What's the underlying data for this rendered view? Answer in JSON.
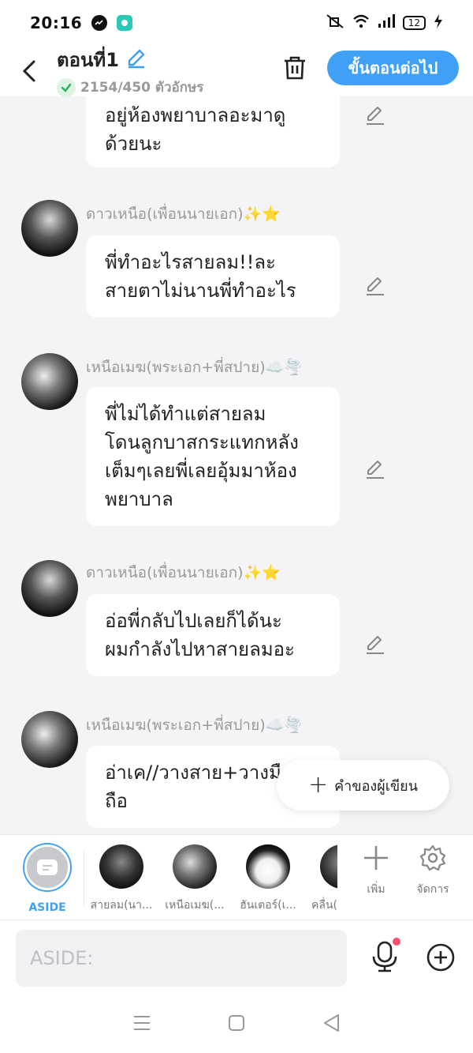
{
  "status_bar": {
    "time": "20:16",
    "battery": "12"
  },
  "header": {
    "title": "ตอนที่1",
    "counter": "2154/450 ตัวอักษร",
    "next_label": "ขั้นตอนต่อไป"
  },
  "messages": [
    {
      "sender": "",
      "text": "อยู่ห้องพยาบาลอะมาดูด้วยนะ",
      "lines": [
        "อยู่ห้องพยาบาลอะมาดู",
        "ด้วยนะ"
      ]
    },
    {
      "sender": "ดาวเหนือ(เพื่อนนายเอก)✨⭐",
      "lines": [
        "พี่ทำอะไรสายลม!!ละ",
        "สายตาไม่นานพี่ทำอะไร"
      ]
    },
    {
      "sender": "เหนือเมฆ(พระเอก+พี่สปาย)☁️🌪️",
      "lines": [
        "พี่ไม่ได้ทำแต่สายลม",
        "โดนลูกบาสกระแทกหลัง",
        "เต็มๆเลยพี่เลยอุ้มมาห้อง",
        "พยาบาล"
      ]
    },
    {
      "sender": "ดาวเหนือ(เพื่อนนายเอก)✨⭐",
      "lines": [
        "อ่อพี่กลับไปเลยก็ได้นะ",
        "ผมกำลังไปหาสายลมอะ"
      ]
    },
    {
      "sender": "เหนือเมฆ(พระเอก+พี่สปาย)☁️🌪️",
      "lines": [
        "อ่าเค//วางสาย+วางมือ",
        "ถือ"
      ]
    }
  ],
  "fab": {
    "label": "คำของผู้เขียน"
  },
  "characters": [
    {
      "label": "ASIDE"
    },
    {
      "label": "สายลม(นา..."
    },
    {
      "label": "เหนือเมฆ(..."
    },
    {
      "label": "ฮันเตอร์(เ..."
    },
    {
      "label": "คลื่น("
    }
  ],
  "tools": {
    "add_label": "เพิ่ม",
    "manage_label": "จัดการ"
  },
  "input": {
    "placeholder": "ASIDE:"
  },
  "colors": {
    "accent": "#3fa0f5",
    "bubble": "#ffffff",
    "background": "#f4f4f6"
  }
}
